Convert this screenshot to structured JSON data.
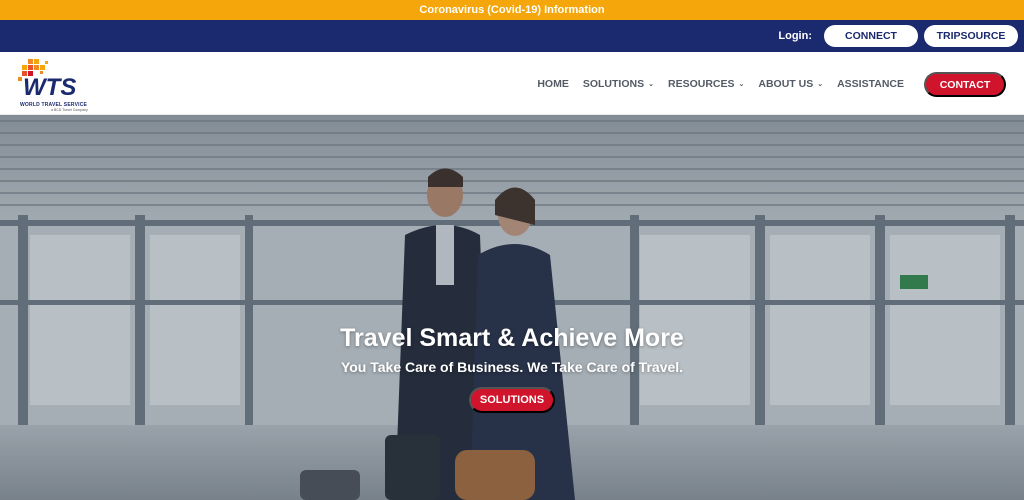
{
  "covid_banner": {
    "text": "Coronavirus (Covid-19) Information"
  },
  "login_bar": {
    "label": "Login:",
    "connect_label": "CONNECT",
    "tripsource_label": "TRIPSOURCE"
  },
  "logo": {
    "wordmark": "WTS",
    "tagline": "WORLD TRAVEL SERVICE",
    "subtag": "a BCD Travel Company"
  },
  "nav": {
    "items": [
      {
        "label": "HOME",
        "has_dropdown": false
      },
      {
        "label": "SOLUTIONS",
        "has_dropdown": true
      },
      {
        "label": "RESOURCES",
        "has_dropdown": true
      },
      {
        "label": "ABOUT US",
        "has_dropdown": true
      },
      {
        "label": "ASSISTANCE",
        "has_dropdown": false
      }
    ],
    "contact_label": "CONTACT"
  },
  "hero": {
    "title": "Travel Smart & Achieve More",
    "subtitle": "You Take Care of Business. We Take Care of Travel.",
    "button_label": "SOLUTIONS"
  },
  "colors": {
    "banner": "#f5a60a",
    "navy": "#1b2a6e",
    "accent_red": "#d0142c",
    "nav_text": "#555b66"
  },
  "icons": {
    "dropdown": "chevron-down-icon",
    "logo_mark": "pixel-squares-icon"
  }
}
